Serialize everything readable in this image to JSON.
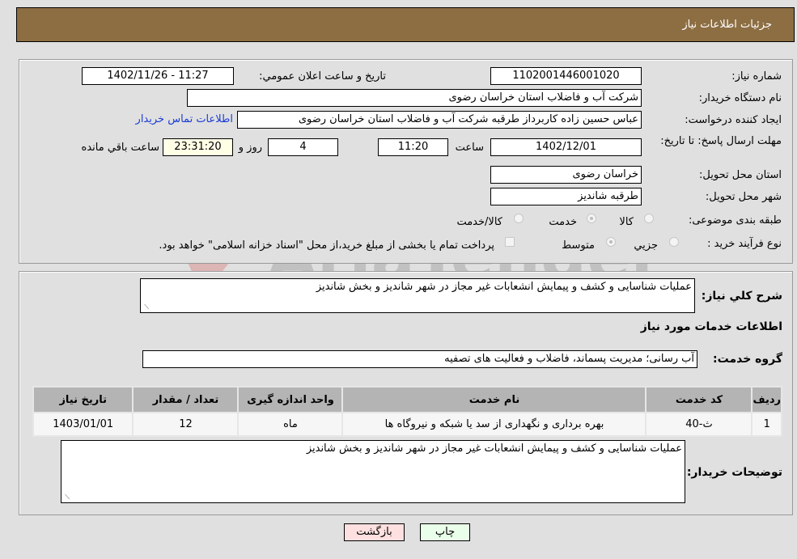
{
  "header": {
    "title": "جزئیات اطلاعات نیاز"
  },
  "form": {
    "need_number_label": "شماره نیاز:",
    "need_number": "1102001446001020",
    "announce_label": "تاریخ و ساعت اعلان عمومي:",
    "announce_value": "1402/11/26 - 11:27",
    "buyer_org_label": "نام دستگاه خریدار:",
    "buyer_org": "شرکت آب و فاضلاب استان خراسان رضوی",
    "creator_label": "ایجاد کننده درخواست:",
    "creator": "عباس حسین زاده کاربرداز طرقبه  شرکت آب و فاضلاب استان خراسان رضوی",
    "contact_link": "اطلاعات تماس خریدار",
    "deadline_label": "مهلت ارسال پاسخ: تا تاریخ:",
    "deadline_date": "1402/12/01",
    "time_label": "ساعت",
    "deadline_time": "11:20",
    "days_value": "4",
    "days_label": "روز و",
    "remaining_time": "23:31:20",
    "remaining_label": "ساعت باقي مانده",
    "province_label": "استان محل تحویل:",
    "province": "خراسان رضوی",
    "city_label": "شهر محل تحویل:",
    "city": "طرقبه شاندیز",
    "category_label": "طبقه بندی موضوعی:",
    "category_options": [
      "کالا",
      "خدمت",
      "کالا/خدمت"
    ],
    "category_selected": "خدمت",
    "process_label": "نوع فرآیند خرید :",
    "process_options": [
      "جزيي",
      "متوسط"
    ],
    "process_selected": "متوسط",
    "payment_note": "پرداخت تمام یا بخشی از مبلغ خرید،از محل \"اسناد خزانه اسلامی\" خواهد بود."
  },
  "details": {
    "summary_label": "شرح کلي نیاز:",
    "summary": "عملیات شناسایی و کشف و پیمایش انشعابات غیر مجاز در شهر شاندیز و بخش شاندیز",
    "services_heading": "اطلاعات خدمات مورد نیاز",
    "service_group_label": "گروه خدمت:",
    "service_group": "آب رسانی؛ مدیریت پسماند، فاضلاب و فعالیت های تصفیه",
    "table": {
      "headers": [
        "ردیف",
        "کد خدمت",
        "نام خدمت",
        "واحد اندازه گیری",
        "تعداد / مقدار",
        "تاریخ نیاز"
      ],
      "rows": [
        [
          "1",
          "ث-40",
          "بهره برداری و نگهداری از سد یا شبکه و نیروگاه ها",
          "ماه",
          "12",
          "1403/01/01"
        ]
      ]
    },
    "buyer_notes_label": "توضیحات خریدار:",
    "buyer_notes": "عملیات شناسایی و کشف و پیمایش انشعابات غیر مجاز در شهر شاندیز و بخش شاندیز"
  },
  "buttons": {
    "print": "چاپ",
    "back": "بازگشت"
  },
  "watermark": {
    "text": "AriaTender.neT"
  },
  "colors": {
    "header_bg": "#8d6e43",
    "link": "#1a3cd6",
    "print_bg": "#eaffea",
    "back_bg": "#ffe0e0",
    "remaining_bg": "#ffffe6"
  }
}
